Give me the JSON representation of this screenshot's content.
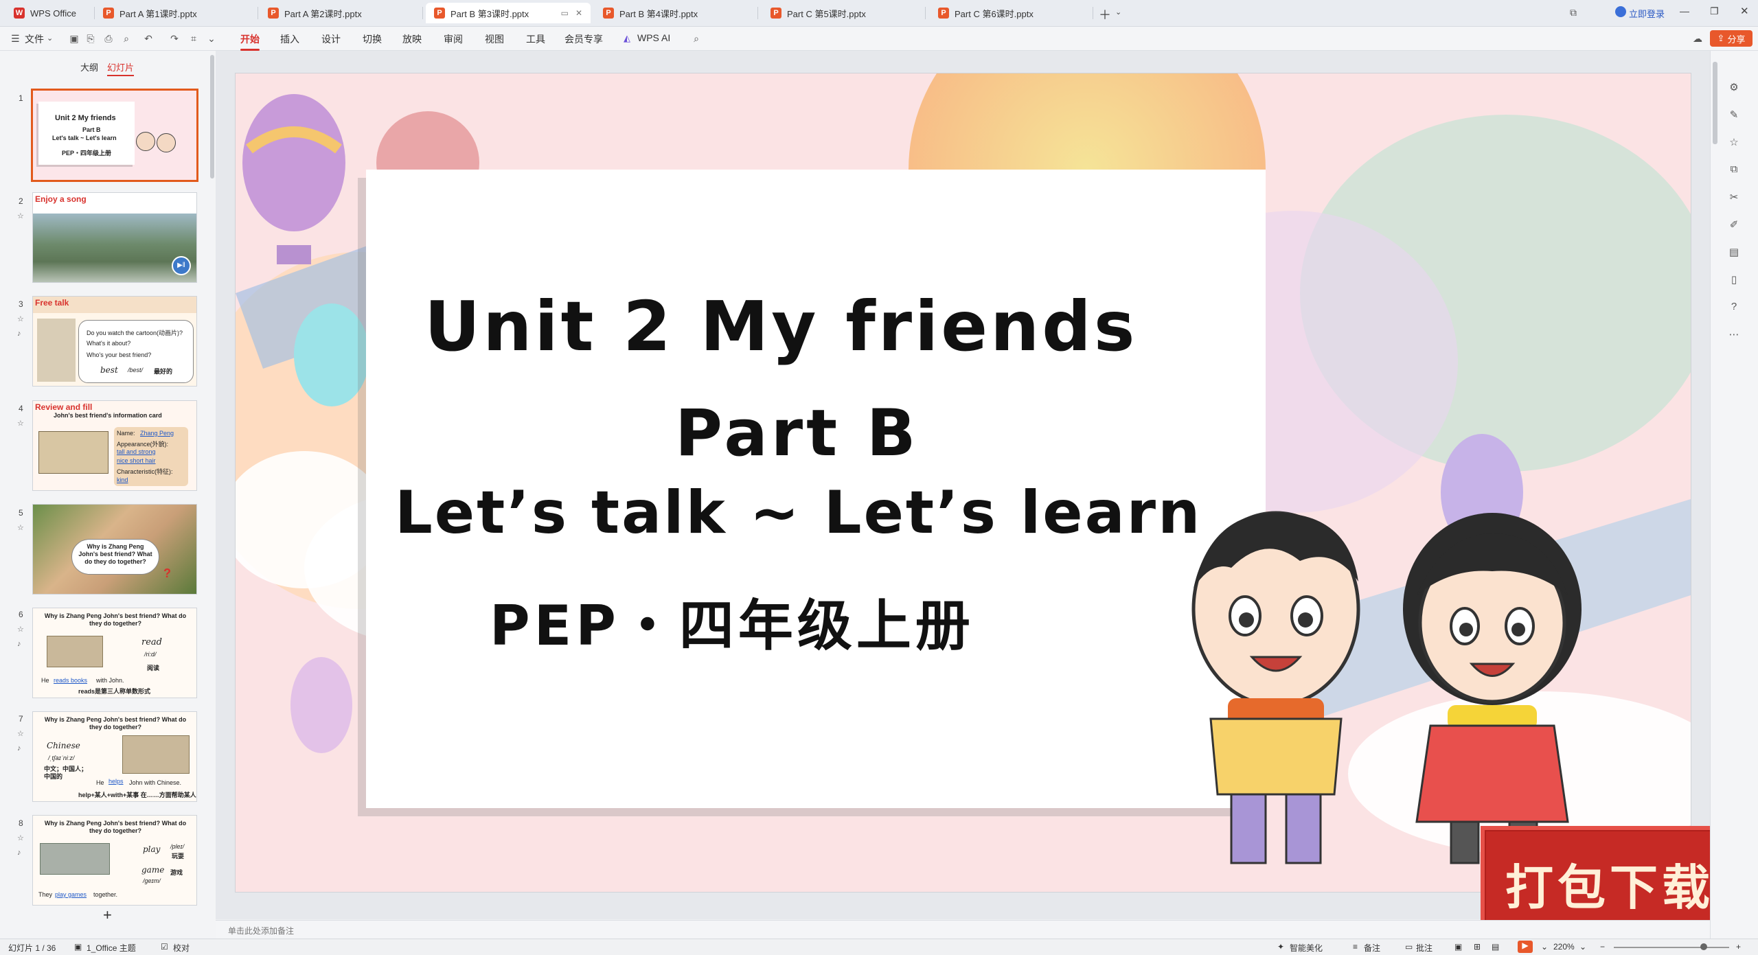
{
  "tabs": [
    {
      "label": "WPS Office",
      "icon": "wps-logo-icon",
      "active": false
    },
    {
      "label": "Part A 第1课时.pptx",
      "icon": "ppt-file-icon",
      "active": false
    },
    {
      "label": "Part A 第2课时.pptx",
      "icon": "ppt-file-icon",
      "active": false
    },
    {
      "label": "Part B 第3课时.pptx",
      "icon": "ppt-file-icon",
      "active": true
    },
    {
      "label": "Part B 第4课时.pptx",
      "icon": "ppt-file-icon",
      "active": false
    },
    {
      "label": "Part C 第5课时.pptx",
      "icon": "ppt-file-icon",
      "active": false
    },
    {
      "label": "Part C 第6课时.pptx",
      "icon": "ppt-file-icon",
      "active": false
    }
  ],
  "window": {
    "login": "立即登录"
  },
  "menubar": {
    "file": "文件",
    "items": [
      "开始",
      "插入",
      "设计",
      "切换",
      "放映",
      "审阅",
      "视图",
      "工具",
      "会员专享",
      "WPS AI"
    ],
    "active": "开始",
    "share": "分享"
  },
  "leftpanel": {
    "tab_outline": "大纲",
    "tab_slides": "幻灯片",
    "add": "+"
  },
  "thumbs": {
    "s1": {
      "num": "1",
      "title": "Unit 2 My friends",
      "part": "Part B",
      "sub": "Let's talk ~ Let's learn",
      "pep": "PEP・四年级上册"
    },
    "s2": {
      "num": "2",
      "label": "Enjoy a song"
    },
    "s3": {
      "num": "3",
      "label": "Free talk",
      "q1": "Do you watch the cartoon(动画片)?",
      "q2": "What's it about?",
      "q3": "Who's your best friend?",
      "word": "best",
      "ipa": "/best/",
      "cn": "最好的"
    },
    "s4": {
      "num": "4",
      "label": "Review and fill",
      "title": "John's best friend's information card",
      "name": "Name:",
      "name_v": "Zhang Peng",
      "app": "Appearance(外貌):",
      "app_v1": "tall and strong",
      "app_v2": "nice short hair",
      "char": "Characteristic(特征):",
      "char_v": "kind"
    },
    "s5": {
      "num": "5",
      "bubble": "Why is Zhang Peng John's best friend? What do they do together?"
    },
    "s6": {
      "num": "6",
      "q": "Why is Zhang Peng John's best friend? What do they do together?",
      "word": "read",
      "ipa": "/ri:d/",
      "cn": "阅读",
      "sent_a": "He",
      "sent_b": "reads books",
      "sent_c": "with John.",
      "note": "reads是第三人称单数形式"
    },
    "s7": {
      "num": "7",
      "q": "Why is Zhang Peng John's best friend? What do they do together?",
      "word": "Chinese",
      "ipa": "/ˌtʃaɪˈniːz/",
      "cn": "中文；中国人；中国的",
      "sent_a": "He",
      "sent_b": "helps",
      "sent_c": "John with Chinese.",
      "note": "help+某人+with+某事 在……方面帮助某人"
    },
    "s8": {
      "num": "8",
      "q": "Why is Zhang Peng John's best friend? What do they do together?",
      "w1": "play",
      "i1": "/pleɪ/",
      "c1": "玩耍",
      "w2": "game",
      "i2": "/ɡeɪm/",
      "c2": "游戏",
      "sent_a": "They",
      "sent_b": "play games",
      "sent_c": "together."
    }
  },
  "slide": {
    "title": "Unit 2 My friends",
    "part": "Part B",
    "subtitle": "Let’s talk ~ Let’s learn",
    "pep": "PEP・四年级上册",
    "download": "打包下载"
  },
  "notes": {
    "placeholder": "单击此处添加备注"
  },
  "status": {
    "slide_of": "幻灯片 1 / 36",
    "theme": "1_Office 主题",
    "proof": "校对",
    "beautify": "智能美化",
    "remarks": "备注",
    "comments": "批注",
    "zoom": "220%"
  },
  "colors": {
    "accent": "#d8322d",
    "active_tab_bg": "#ffffff",
    "selection": "#e25a1c"
  }
}
